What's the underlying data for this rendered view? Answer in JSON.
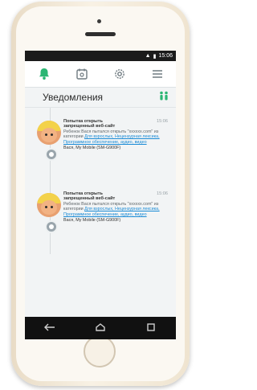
{
  "status_bar": {
    "time": "15:06"
  },
  "header": {
    "title": "Уведомления"
  },
  "nav": {
    "icons": [
      "bell-icon",
      "calendar-icon",
      "gear-icon",
      "menu-icon"
    ]
  },
  "notifications": [
    {
      "title": "Попытка открыть запрещенный веб-сайт",
      "time": "15:06",
      "text": "Ребенок Вася пытался открыть \"xxxxxx.com\" из категории",
      "link": "Для взрослых, Нецензурная лексика, Программное обеспечение, аудио, видео",
      "device": "Вася, My Mobile (SM-G900F)"
    },
    {
      "title": "Попытка открыть запрещенный веб-сайт",
      "time": "15:06",
      "text": "Ребенок Вася пытался открыть \"xxxxxx.com\" из категории",
      "link": "Для взрослых, Нецензурная лексика, Программное обеспечение, аудио, видео",
      "device": "Вася, My Mobile (SM-G900F)"
    }
  ],
  "colors": {
    "accent": "#2bb673",
    "link": "#1a8bd6",
    "statusbar": "#1b1b1b"
  }
}
